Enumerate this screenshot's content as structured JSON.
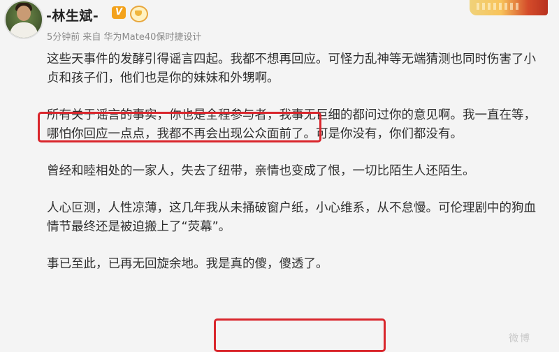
{
  "header": {
    "username": "-林生斌-",
    "verified_badge": "V",
    "meta": "5分钟前 来自 华为Mate40保时捷设计",
    "icons": [
      "avatar",
      "verified-badge-icon",
      "vip-crown-icon",
      "banner-decoration"
    ]
  },
  "post": {
    "paragraphs": [
      "这些天事件的发酵引得谣言四起。我都不想再回应。可怪力乱神等无端猜测也同时伤害了小贞和孩子们，他们也是你的妹妹和外甥啊。",
      "所有关于谣言的事实，你也是全程参与者，我事无巨细的都问过你的意见啊。我一直在等，哪怕你回应一点点，我都不再会出现公众面前了。可是你没有，你们都没有。",
      "曾经和睦相处的一家人，失去了纽带，亲情也变成了恨，一切比陌生人还陌生。",
      "人心叵测，人性凉薄，这几年我从未捅破窗户纸，小心维系，从不怠慢。可伦理剧中的狗血情节最终还是被迫搬上了“荧幕”。",
      "事已至此，已再无回旋余地。我是真的傻，傻透了。"
    ]
  },
  "watermark": "微博",
  "colors": {
    "highlight_border": "#d9262c",
    "meta_text": "#8a8a8a",
    "verified": "#f3a21c"
  }
}
